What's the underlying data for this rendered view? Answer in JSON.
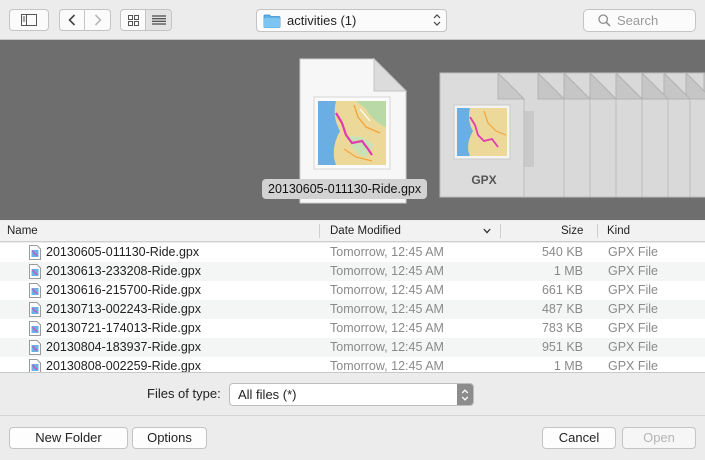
{
  "toolbar": {
    "sidebar_toggle_icon": "sidebar-icon",
    "back_icon": "chevron-left-icon",
    "forward_icon": "chevron-right-icon",
    "icon_view_icon": "grid-icon",
    "list_view_icon": "list-icon",
    "location": "activities (1)",
    "search_placeholder": "Search"
  },
  "preview": {
    "selected_file_name": "20130605-011130-Ride.gpx",
    "stack_badge": "GPX"
  },
  "columns": {
    "name": "Name",
    "date_modified": "Date Modified",
    "size": "Size",
    "kind": "Kind"
  },
  "files": [
    {
      "name": "20130605-011130-Ride.gpx",
      "date": "Tomorrow, 12:45 AM",
      "size": "540 KB",
      "kind": "GPX File"
    },
    {
      "name": "20130613-233208-Ride.gpx",
      "date": "Tomorrow, 12:45 AM",
      "size": "1 MB",
      "kind": "GPX File"
    },
    {
      "name": "20130616-215700-Ride.gpx",
      "date": "Tomorrow, 12:45 AM",
      "size": "661 KB",
      "kind": "GPX File"
    },
    {
      "name": "20130713-002243-Ride.gpx",
      "date": "Tomorrow, 12:45 AM",
      "size": "487 KB",
      "kind": "GPX File"
    },
    {
      "name": "20130721-174013-Ride.gpx",
      "date": "Tomorrow, 12:45 AM",
      "size": "783 KB",
      "kind": "GPX File"
    },
    {
      "name": "20130804-183937-Ride.gpx",
      "date": "Tomorrow, 12:45 AM",
      "size": "951 KB",
      "kind": "GPX File"
    },
    {
      "name": "20130808-002259-Ride.gpx",
      "date": "Tomorrow, 12:45 AM",
      "size": "1 MB",
      "kind": "GPX File"
    }
  ],
  "filter": {
    "label": "Files of type:",
    "value": "All files (*)"
  },
  "buttons": {
    "new_folder": "New Folder",
    "options": "Options",
    "cancel": "Cancel",
    "open": "Open"
  }
}
